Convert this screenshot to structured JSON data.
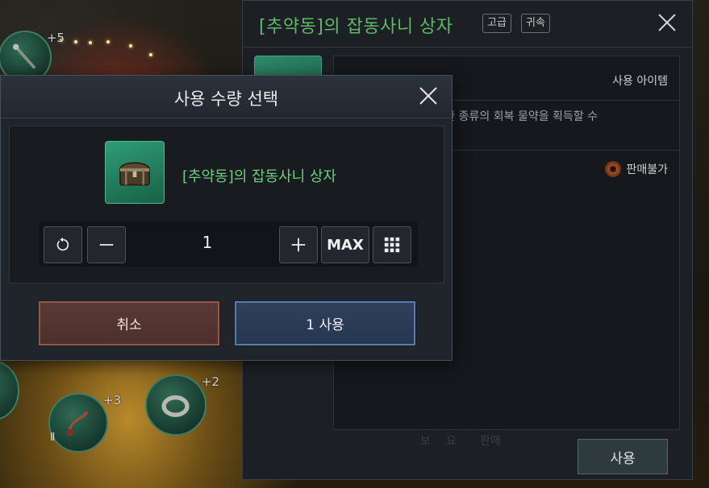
{
  "background": {
    "slot_badges": [
      "+5",
      "+3",
      "+2"
    ],
    "slot_glyph": "Ⅱ"
  },
  "detail_panel": {
    "title": "[추약동]의 잡동사니 상자",
    "tags": [
      "고급",
      "귀속"
    ],
    "item_kind": "사용 아이템",
    "description": "중 한 종류의 회복 물약을 획득할 수",
    "sell_status": "판매불가",
    "use_label": "사용",
    "obscured_tabs": [
      "보",
      "요",
      "판매"
    ],
    "title_color": "#5fb86a"
  },
  "modal": {
    "title": "사용 수량 선택",
    "item_name": "[추약동]의 잡동사니 상자",
    "item_name_color": "#6fcf7c",
    "quantity": "1",
    "max_label": "MAX",
    "cancel_label": "취소",
    "confirm_label": "1 사용",
    "icons": {
      "close": "close-icon",
      "reset": "reset-icon",
      "decrement": "minus-icon",
      "increment": "plus-icon",
      "keypad": "keypad-icon",
      "item": "treasure-chest-icon"
    }
  }
}
